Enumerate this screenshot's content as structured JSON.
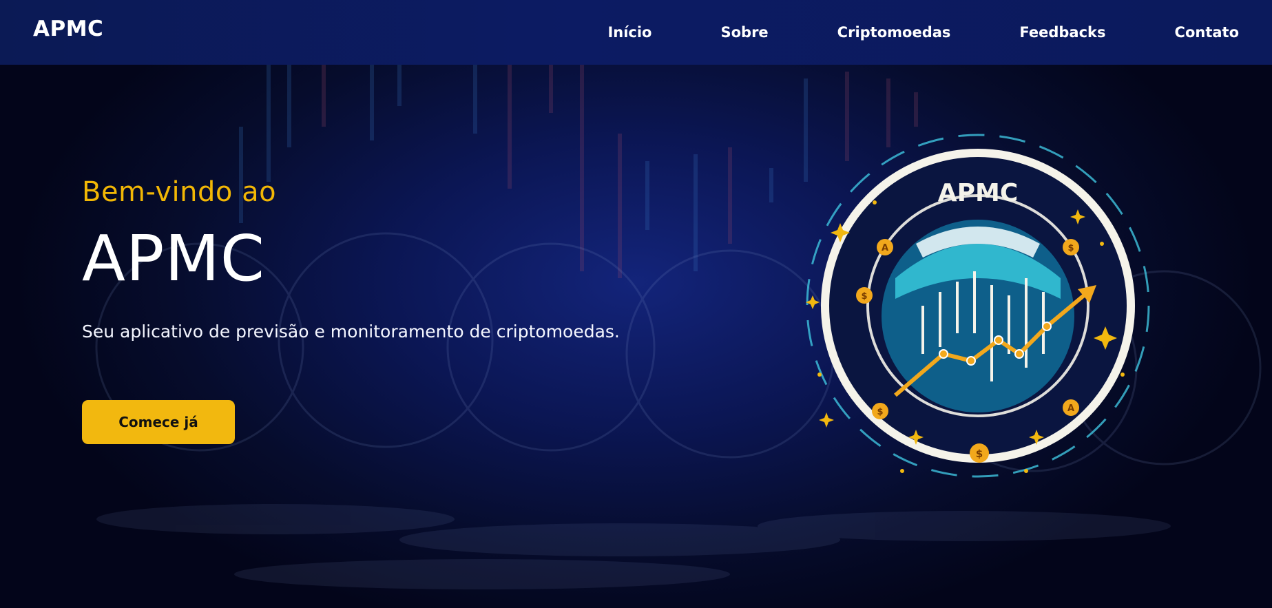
{
  "header": {
    "brand": "APMC",
    "nav": [
      {
        "label": "Início"
      },
      {
        "label": "Sobre"
      },
      {
        "label": "Criptomoedas"
      },
      {
        "label": "Feedbacks"
      },
      {
        "label": "Contato"
      }
    ]
  },
  "hero": {
    "welcome": "Bem-vindo ao",
    "title": "APMC",
    "subtitle": "Seu aplicativo de previsão e monitoramento de criptomoedas.",
    "cta_label": "Comece já"
  },
  "logo": {
    "text": "APMC",
    "coin_symbols": [
      "A",
      "$",
      "$",
      "$",
      "A",
      "$"
    ]
  },
  "colors": {
    "accent": "#f2b80f",
    "header_bg": "#0c1b63",
    "hero_bg": "#060c2c",
    "logo_ring": "#f5f3ea",
    "logo_teal": "#1aa6c2"
  }
}
